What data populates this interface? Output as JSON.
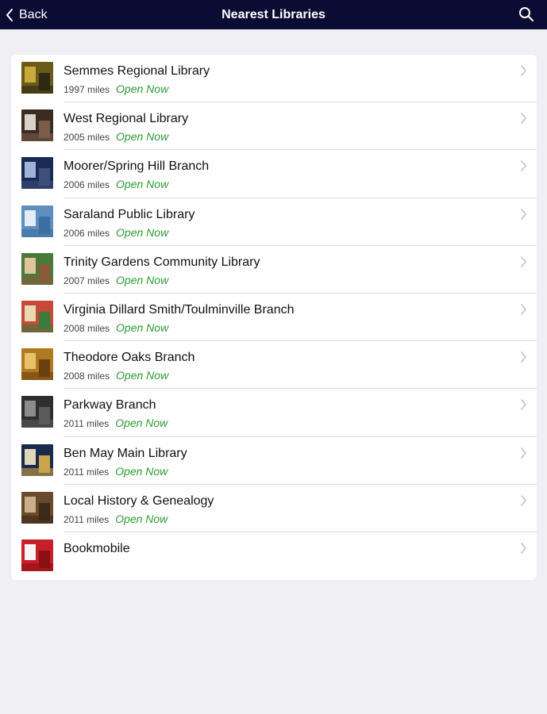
{
  "header": {
    "back_label": "Back",
    "title": "Nearest Libraries",
    "background": "#0b0c34"
  },
  "status_color": "#2e9a35",
  "libraries": [
    {
      "name": "Semmes Regional Library",
      "distance": "1997 miles",
      "status": "Open Now",
      "thumb": [
        "#6b5a1a",
        "#c9a93a",
        "#2c2a14"
      ]
    },
    {
      "name": "West Regional Library",
      "distance": "2005 miles",
      "status": "Open Now",
      "thumb": [
        "#3a2b23",
        "#d9d2c8",
        "#7a5c48"
      ]
    },
    {
      "name": "Moorer/Spring Hill Branch",
      "distance": "2006 miles",
      "status": "Open Now",
      "thumb": [
        "#1b2a55",
        "#9fb3d9",
        "#3d4f7a"
      ]
    },
    {
      "name": "Saraland Public Library",
      "distance": "2006 miles",
      "status": "Open Now",
      "thumb": [
        "#5f8fbf",
        "#e3edf5",
        "#3a6f9f"
      ]
    },
    {
      "name": "Trinity Gardens Community Library",
      "distance": "2007 miles",
      "status": "Open Now",
      "thumb": [
        "#4a7a3a",
        "#e0c59a",
        "#8a5a3a"
      ]
    },
    {
      "name": "Virginia Dillard Smith/Toulminville Branch",
      "distance": "2008 miles",
      "status": "Open Now",
      "thumb": [
        "#c8483a",
        "#e8d9b0",
        "#3a7a3a"
      ]
    },
    {
      "name": "Theodore Oaks Branch",
      "distance": "2008 miles",
      "status": "Open Now",
      "thumb": [
        "#b07a20",
        "#e8c26a",
        "#6b3f12"
      ]
    },
    {
      "name": "Parkway Branch",
      "distance": "2011 miles",
      "status": "Open Now",
      "thumb": [
        "#2e2e2e",
        "#8c8c8c",
        "#5a5a5a"
      ]
    },
    {
      "name": "Ben May Main Library",
      "distance": "2011 miles",
      "status": "Open Now",
      "thumb": [
        "#1a2a4a",
        "#e0d6b8",
        "#c9a44a"
      ]
    },
    {
      "name": "Local History & Genealogy",
      "distance": "2011 miles",
      "status": "Open Now",
      "thumb": [
        "#6a4a2a",
        "#c9b08a",
        "#3a2a1a"
      ]
    },
    {
      "name": "Bookmobile",
      "distance": "",
      "status": "",
      "thumb": [
        "#c8202a",
        "#f5f5f5",
        "#8a1018"
      ]
    }
  ]
}
